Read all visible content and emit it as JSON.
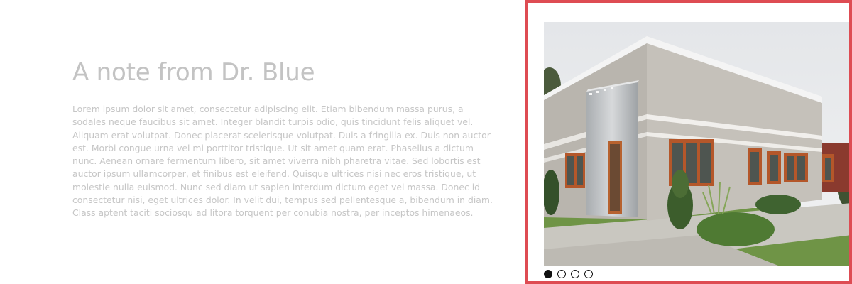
{
  "note": {
    "title": "A note from Dr. Blue",
    "body": "Lorem ipsum dolor sit amet, consectetur adipiscing elit. Etiam bibendum massa purus, a sodales neque faucibus sit amet. Integer blandit turpis odio, quis tincidunt felis aliquet vel. Aliquam erat volutpat. Donec placerat scelerisque volutpat. Duis a fringilla ex. Duis non auctor est. Morbi congue urna vel mi porttitor tristique. Ut sit amet quam erat. Phasellus a dictum nunc. Aenean ornare fermentum libero, sit amet viverra nibh pharetra vitae. Sed lobortis est auctor ipsum ullamcorper, et finibus est eleifend. Quisque ultrices nisi nec eros tristique, ut molestie nulla euismod. Nunc sed diam ut sapien interdum dictum eget vel massa. Donec id consectetur nisi, eget ultrices dolor. In velit dui, tempus sed pellentesque a, bibendum in diam. Class aptent taciti sociosqu ad litora torquent per conubia nostra, per inceptos himenaeos."
  },
  "slideshow": {
    "accent_color": "#de4c53",
    "slide_count": 4,
    "active_slide": 1,
    "current_image": "building-photo"
  }
}
